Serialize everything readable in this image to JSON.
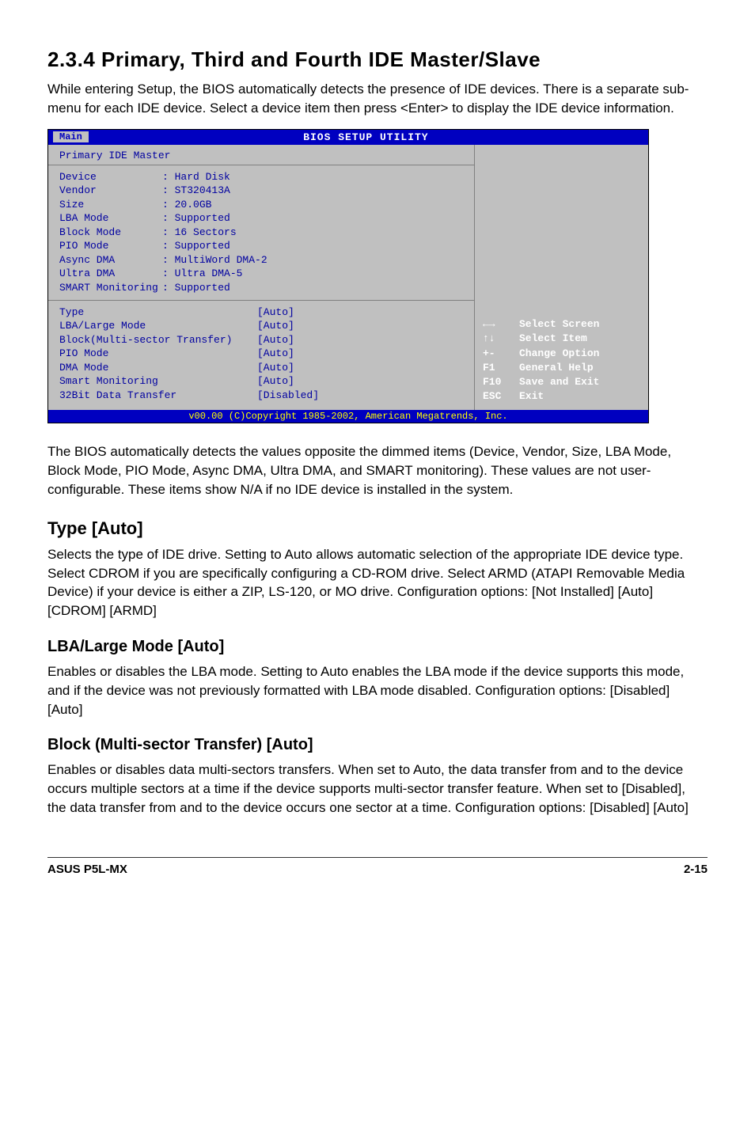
{
  "section": {
    "title": "2.3.4   Primary, Third and Fourth IDE Master/Slave",
    "intro": "While entering Setup, the BIOS automatically detects the presence of IDE devices. There is a separate sub-menu for each IDE device. Select a device item then press <Enter> to display the IDE device information."
  },
  "bios": {
    "header_title": "BIOS SETUP UTILITY",
    "tab": "Main",
    "panel_title": "Primary IDE Master",
    "info": [
      {
        "label": "Device",
        "value": "Hard Disk"
      },
      {
        "label": "Vendor",
        "value": "ST320413A"
      },
      {
        "label": "Size",
        "value": "20.0GB"
      },
      {
        "label": "LBA Mode",
        "value": "Supported"
      },
      {
        "label": "Block Mode",
        "value": "16 Sectors"
      },
      {
        "label": "PIO Mode",
        "value": "Supported"
      },
      {
        "label": "Async DMA",
        "value": "MultiWord DMA-2"
      },
      {
        "label": "Ultra DMA",
        "value": "Ultra DMA-5"
      },
      {
        "label": "SMART Monitoring",
        "value": "Supported"
      }
    ],
    "options": [
      {
        "label": "Type",
        "value": "[Auto]"
      },
      {
        "label": "LBA/Large Mode",
        "value": "[Auto]"
      },
      {
        "label": "Block(Multi-sector Transfer)",
        "value": "[Auto]"
      },
      {
        "label": "PIO Mode",
        "value": "[Auto]"
      },
      {
        "label": "DMA Mode",
        "value": "[Auto]"
      },
      {
        "label": "Smart Monitoring",
        "value": "[Auto]"
      },
      {
        "label": "32Bit Data Transfer",
        "value": "[Disabled]"
      }
    ],
    "help": [
      {
        "key": "←→",
        "text": "Select Screen"
      },
      {
        "key": "↑↓",
        "text": "Select Item"
      },
      {
        "key": "+-",
        "text": "Change Option"
      },
      {
        "key": "F1",
        "text": "General Help"
      },
      {
        "key": "F10",
        "text": "Save and Exit"
      },
      {
        "key": "ESC",
        "text": "Exit"
      }
    ],
    "footer": "v00.00 (C)Copyright 1985-2002, American Megatrends, Inc."
  },
  "paragraphs": {
    "after_bios": "The BIOS automatically detects the values opposite the dimmed items (Device, Vendor, Size, LBA Mode, Block Mode, PIO Mode, Async DMA, Ultra DMA, and SMART monitoring). These values are not user-configurable. These items show N/A if no IDE device is installed in the system.",
    "type_auto_title": "Type [Auto]",
    "type_auto_body": "Selects the type of IDE drive. Setting to Auto allows automatic selection of the appropriate IDE device type. Select CDROM if you are specifically configuring a CD-ROM drive. Select ARMD (ATAPI Removable Media Device) if your device is either a ZIP, LS-120, or MO drive. Configuration options: [Not Installed] [Auto] [CDROM] [ARMD]",
    "lba_title": "LBA/Large Mode [Auto]",
    "lba_body": "Enables or disables the LBA mode. Setting to Auto enables the LBA mode if the device supports this mode, and if the device was not previously formatted with LBA mode disabled. Configuration options: [Disabled] [Auto]",
    "block_title": "Block (Multi-sector Transfer) [Auto]",
    "block_body": "Enables or disables data multi-sectors transfers. When set to Auto, the data transfer from and to the device occurs multiple sectors at a time if the device supports multi-sector transfer feature. When set to [Disabled], the data transfer from and to the device occurs one sector at a time. Configuration options: [Disabled] [Auto]"
  },
  "footer": {
    "left": "ASUS P5L-MX",
    "right": "2-15"
  }
}
